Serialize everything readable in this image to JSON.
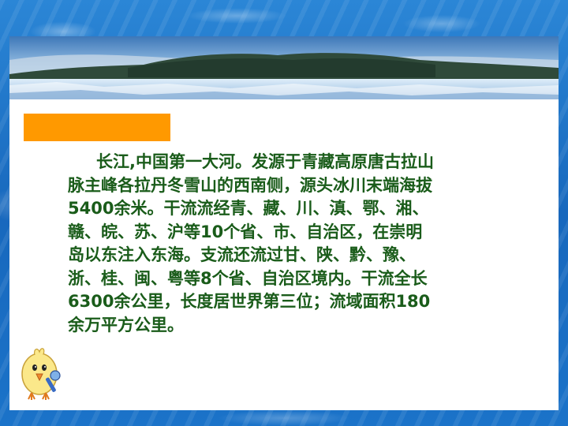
{
  "slide": {
    "paragraph_lines": [
      "长江,中国第一大河。发源于青藏高原唐古拉山",
      "脉主峰各拉丹冬雪山的西南侧，源头冰川末端海拔",
      "5400余米。干流流经青、藏、川、滇、鄂、湘、",
      "赣、皖、苏、沪等10个省、市、自治区，在崇明",
      "岛以东注入东海。支流还流过甘、陕、黔、豫、",
      "浙、桂、闽、粤等8个省、自治区境内。干流全长",
      "6300余公里，长度居世界第三位；流域面积180",
      "余万平方公里。"
    ]
  },
  "colors": {
    "text": "#1a5c1a",
    "header_bar": "#ff9900",
    "background": "#1a6fc2",
    "panel": "#ffffff"
  },
  "icons": {
    "banner": "mountain-lake-photo",
    "mascot": "singing-chick-icon"
  }
}
